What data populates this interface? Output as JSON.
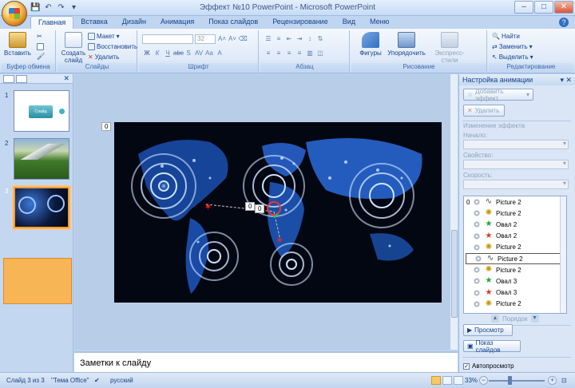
{
  "window": {
    "title": "Эффект №10 PowerPoint - Microsoft PowerPoint",
    "controls": [
      "–",
      "□",
      "✕"
    ]
  },
  "qat": [
    "💾",
    "↶",
    "↷",
    "▾"
  ],
  "tabs": [
    "Главная",
    "Вставка",
    "Дизайн",
    "Анимация",
    "Показ слайдов",
    "Рецензирование",
    "Вид",
    "Меню"
  ],
  "ribbon": {
    "clipboard": {
      "paste": "Вставить",
      "label": "Буфер обмена"
    },
    "slides": {
      "new_slide": "Создать слайд",
      "layout": "Макет",
      "restore": "Восстановить",
      "delete": "Удалить",
      "label": "Слайды"
    },
    "font": {
      "font_name": "",
      "font_size": "32",
      "label": "Шрифт"
    },
    "paragraph": {
      "label": "Абзац"
    },
    "drawing": {
      "shapes": "Фигуры",
      "arrange": "Упорядочить",
      "quick_styles": "Экспресс-стили",
      "label": "Рисование"
    },
    "editing": {
      "find": "Найти",
      "replace": "Заменить",
      "select": "Выделить",
      "label": "Редактирование"
    }
  },
  "thumbnails": [
    {
      "number": "1",
      "caption": "Слайд"
    },
    {
      "number": "2",
      "caption": ""
    },
    {
      "number": "3",
      "caption": ""
    }
  ],
  "slide": {
    "badges": [
      "0",
      "0",
      "0"
    ]
  },
  "notes": {
    "placeholder": "Заметки к слайду"
  },
  "task_pane": {
    "title": "Настройка анимации",
    "add_effect": "Добавить эффект",
    "remove": "Удалить",
    "change_effect": "Изменение эффекта",
    "start_label": "Начало:",
    "property_label": "Свойство:",
    "speed_label": "Скорость:",
    "items": [
      {
        "num": "0",
        "type": "path",
        "name": "Picture 2"
      },
      {
        "num": "",
        "type": "spin",
        "name": "Picture 2"
      },
      {
        "num": "",
        "type": "star-green",
        "name": "Овал 2"
      },
      {
        "num": "",
        "type": "star-red",
        "name": "Овал 2"
      },
      {
        "num": "",
        "type": "spin",
        "name": "Picture 2"
      },
      {
        "num": "",
        "type": "path",
        "name": "Picture 2"
      },
      {
        "num": "",
        "type": "spin",
        "name": "Picture 2"
      },
      {
        "num": "",
        "type": "star-green",
        "name": "Овал 3"
      },
      {
        "num": "",
        "type": "star-red",
        "name": "Овал 3"
      },
      {
        "num": "",
        "type": "spin",
        "name": "Picture 2"
      }
    ],
    "reorder_label": "Порядок",
    "preview": "Просмотр",
    "slideshow": "Показ слайдов",
    "autopreview": "Автопросмотр"
  },
  "status": {
    "slide_info": "Слайд 3 из 3",
    "theme": "\"Тема Office\"",
    "language": "русский",
    "zoom": "33%"
  }
}
